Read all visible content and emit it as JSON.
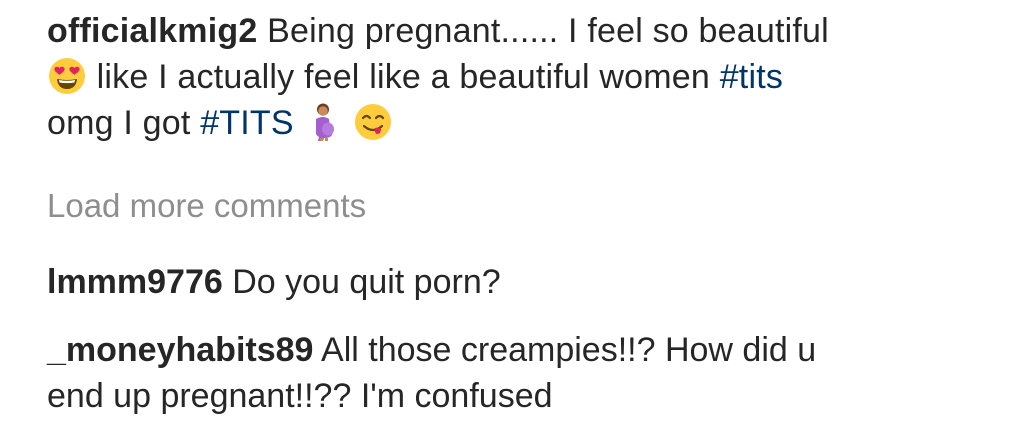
{
  "post": {
    "username": "officialkmig2",
    "text_part1": "Being pregnant...... I feel so beautiful",
    "text_part2": "like I actually feel like a beautiful women",
    "hashtag1": "#tits",
    "text_part3": "omg I got",
    "hashtag2": "#TITS",
    "emojis": [
      "heart-eyes-emoji",
      "pregnant-woman-emoji",
      "yum-face-emoji"
    ]
  },
  "load_more": {
    "label": "Load more comments"
  },
  "comments": [
    {
      "username": "lmmm9776",
      "text": "Do you quit porn?"
    },
    {
      "username": "_moneyhabits89",
      "text_line1": "All those creampies!!? How did u",
      "text_line2": "end up pregnant!!?? I'm confused"
    }
  ],
  "colors": {
    "text": "#262626",
    "hashtag": "#003569",
    "muted": "#8e8e8e",
    "emoji_yellow": "#FFCC3E",
    "emoji_heart": "#E0245E",
    "pregnant_woman_dress": "#A45ED0"
  }
}
